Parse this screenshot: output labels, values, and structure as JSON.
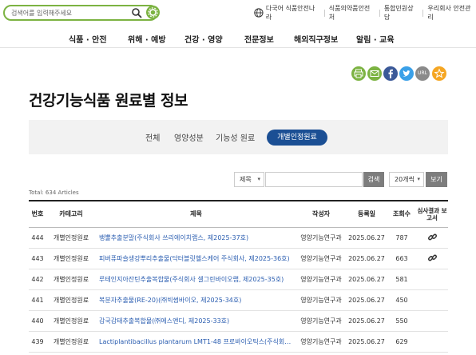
{
  "search": {
    "placeholder": "검색어를 입력해주세요"
  },
  "util": {
    "links": [
      "다국어 식품안전나라",
      "식품의약품안전처",
      "통합민원상담",
      "우리회사 안전관리"
    ]
  },
  "gnb": {
    "items": [
      "식품 · 안전",
      "위해 · 예방",
      "건강 · 영양",
      "전문정보",
      "해외직구정보",
      "알림 · 교육"
    ]
  },
  "share": {
    "print_icon": "print-icon",
    "mail_icon": "mail-icon",
    "facebook_icon": "facebook-icon",
    "twitter_icon": "twitter-icon",
    "url_label": "URL",
    "star_icon": "star-icon",
    "colors": {
      "print": "#7cb342",
      "mail": "#7cb342",
      "facebook": "#3b5998",
      "twitter": "#3aa0e8",
      "url": "#8a8a8a",
      "star": "#f5a623"
    }
  },
  "page": {
    "title": "건강기능식품 원료별 정보"
  },
  "tabs": [
    "전체",
    "영양성분",
    "기능성 원료",
    "개별인정원료"
  ],
  "filters": {
    "field_select": "제목",
    "search_btn": "검색",
    "per_page": "20개씩",
    "view_btn": "보기"
  },
  "list": {
    "total": "Total: 634 Articles",
    "headers": [
      "번호",
      "카테고리",
      "제목",
      "작성자",
      "등록일",
      "조회수",
      "심사결과 보고서"
    ],
    "rows": [
      {
        "no": "444",
        "category": "개별인정원료",
        "title": "뱅뿔추출분말(주식회사 쓰리에이치랩스, 제2025-37호)",
        "author": "영양기능연구과",
        "date": "2025.06.27",
        "views": "787",
        "report": true
      },
      {
        "no": "443",
        "category": "개별인정원료",
        "title": "피버퓨파슬생강뿌리추출물(닥터블릿헬스케어 주식회사, 제2025-36호)",
        "author": "영양기능연구과",
        "date": "2025.06.27",
        "views": "663",
        "report": true
      },
      {
        "no": "442",
        "category": "개별인정원료",
        "title": "루테인지아잔틴추출복합물(주식회사 셀그린바이오랩, 제2025-35호)",
        "author": "영양기능연구과",
        "date": "2025.06.27",
        "views": "581",
        "report": false
      },
      {
        "no": "441",
        "category": "개별인정원료",
        "title": "복분자추출물(RE-20)(㈜빅썸바이오, 제2025-34호)",
        "author": "영양기능연구과",
        "date": "2025.06.27",
        "views": "450",
        "report": false
      },
      {
        "no": "440",
        "category": "개별인정원료",
        "title": "감국감태추출복합물(㈜에스앤디, 제2025-33호)",
        "author": "영양기능연구과",
        "date": "2025.06.27",
        "views": "550",
        "report": false
      },
      {
        "no": "439",
        "category": "개별인정원료",
        "title": "Lactiplantibacillus plantarum LMT1-48 프로바이오틱스(주식회사 메...",
        "author": "영양기능연구과",
        "date": "2025.06.27",
        "views": "629",
        "report": false
      }
    ]
  }
}
